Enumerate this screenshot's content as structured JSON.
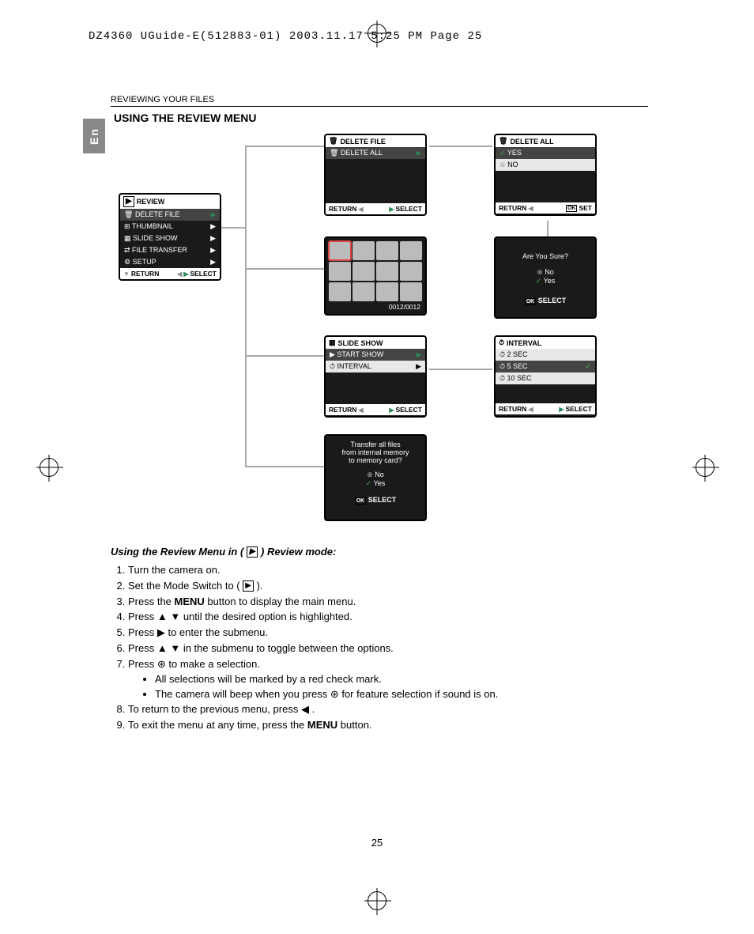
{
  "header_line": "DZ4360 UGuide-E(512883-01)  2003.11.17  5:25 PM  Page 25",
  "section_tag": "En",
  "breadcrumb": "REVIEWING YOUR FILES",
  "page_title": "USING THE REVIEW MENU",
  "page_number": "25",
  "review_menu": {
    "title": "REVIEW",
    "items": [
      "DELETE FILE",
      "THUMBNAIL",
      "SLIDE SHOW",
      "FILE TRANSFER",
      "SETUP"
    ],
    "footer_left": "RETURN",
    "footer_right": "SELECT"
  },
  "delete_file_menu": {
    "title": "DELETE FILE",
    "item": "DELETE ALL",
    "footer_left": "RETURN",
    "footer_right": "SELECT"
  },
  "delete_all_menu": {
    "title": "DELETE ALL",
    "yes": "YES",
    "no": "NO",
    "footer_left": "RETURN",
    "footer_right": "SET"
  },
  "confirm_box": {
    "question": "Are You Sure?",
    "no": "No",
    "yes": "Yes",
    "footer": "SELECT"
  },
  "thumbnail_count": "0012/0012",
  "slideshow_menu": {
    "title": "SLIDE SHOW",
    "start": "START SHOW",
    "interval": "INTERVAL",
    "footer_left": "RETURN",
    "footer_right": "SELECT"
  },
  "interval_menu": {
    "title": "INTERVAL",
    "opt1": "2 SEC",
    "opt2": "5 SEC",
    "opt3": "10 SEC",
    "footer_left": "RETURN",
    "footer_right": "SELECT"
  },
  "transfer_box": {
    "line1": "Transfer all files",
    "line2": "from internal memory",
    "line3": "to memory card?",
    "no": "No",
    "yes": "Yes",
    "footer": "SELECT"
  },
  "instructions": {
    "lead_before": "Using the Review Menu in (",
    "lead_after": ") Review mode:",
    "steps": [
      {
        "text": "Turn the camera on."
      },
      {
        "pre": "Set the Mode Switch to (",
        "post": ")."
      },
      {
        "pre": "Press the ",
        "bold": "MENU",
        "post": " button to display the main menu."
      },
      {
        "pre": "Press ",
        "icons": "▲ ▼",
        "post": " until the desired option is highlighted."
      },
      {
        "pre": "Press ",
        "icons": "▶",
        "post": " to enter the submenu."
      },
      {
        "pre": "Press ",
        "icons": "▲ ▼",
        "post": " in the submenu to toggle between the options."
      },
      {
        "pre": "Press ",
        "icons": "⊛",
        "post": " to make a selection."
      }
    ],
    "sub_bullets": [
      "All selections will be marked by a red check mark.",
      "The camera will beep when you press ⊛ for feature selection if sound is on."
    ],
    "step8_pre": "To return to the previous menu, press ",
    "step8_icon": "◀",
    "step8_post": " .",
    "step9_pre": "To exit the menu at any time, press the ",
    "step9_bold": "MENU",
    "step9_post": " button."
  }
}
